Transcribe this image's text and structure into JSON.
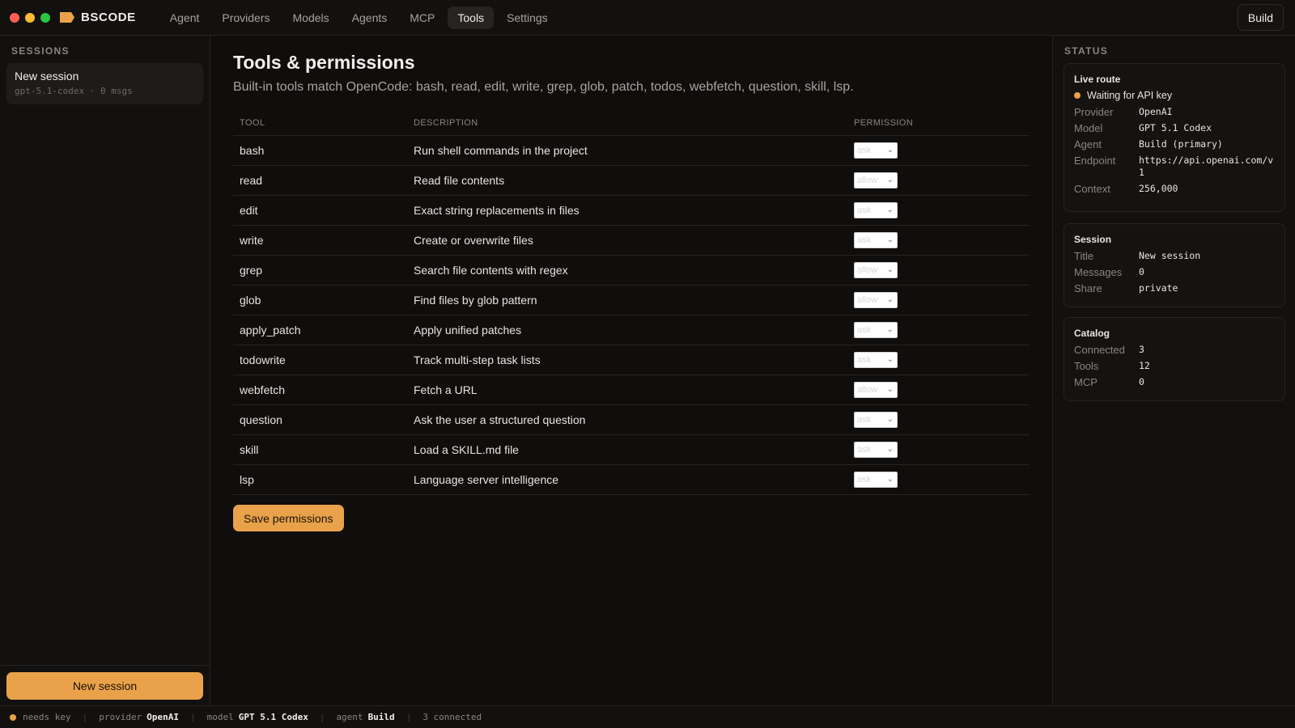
{
  "window": {
    "controls": [
      "#ff5f57",
      "#febc2e",
      "#28c840"
    ],
    "brand": "BSCODE",
    "accent_color": "#e9a24a"
  },
  "nav": {
    "tabs": [
      {
        "label": "Agent"
      },
      {
        "label": "Providers"
      },
      {
        "label": "Models"
      },
      {
        "label": "Agents"
      },
      {
        "label": "MCP"
      },
      {
        "label": "Tools",
        "active": true
      },
      {
        "label": "Settings"
      }
    ],
    "build_label": "Build"
  },
  "sidebar": {
    "title": "SESSIONS",
    "sessions": [
      {
        "title": "New session",
        "meta": "gpt-5.1-codex · 0 msgs"
      }
    ],
    "new_session_label": "New session"
  },
  "main": {
    "title": "Tools & permissions",
    "subtitle": "Built-in tools match OpenCode: bash, read, edit, write, grep, glob, patch, todos, webfetch, question, skill, lsp.",
    "columns": [
      "TOOL",
      "DESCRIPTION",
      "PERMISSION"
    ],
    "tools": [
      {
        "name": "bash",
        "description": "Run shell commands in the project",
        "permission": "ask"
      },
      {
        "name": "read",
        "description": "Read file contents",
        "permission": "allow"
      },
      {
        "name": "edit",
        "description": "Exact string replacements in files",
        "permission": "ask"
      },
      {
        "name": "write",
        "description": "Create or overwrite files",
        "permission": "ask"
      },
      {
        "name": "grep",
        "description": "Search file contents with regex",
        "permission": "allow"
      },
      {
        "name": "glob",
        "description": "Find files by glob pattern",
        "permission": "allow"
      },
      {
        "name": "apply_patch",
        "description": "Apply unified patches",
        "permission": "ask"
      },
      {
        "name": "todowrite",
        "description": "Track multi-step task lists",
        "permission": "ask"
      },
      {
        "name": "webfetch",
        "description": "Fetch a URL",
        "permission": "allow"
      },
      {
        "name": "question",
        "description": "Ask the user a structured question",
        "permission": "ask"
      },
      {
        "name": "skill",
        "description": "Load a SKILL.md file",
        "permission": "ask"
      },
      {
        "name": "lsp",
        "description": "Language server intelligence",
        "permission": "ask"
      }
    ],
    "save_label": "Save permissions"
  },
  "status": {
    "title": "STATUS",
    "live_route": {
      "title": "Live route",
      "state": "Waiting for API key",
      "rows": [
        {
          "k": "Provider",
          "v": "OpenAI"
        },
        {
          "k": "Model",
          "v": "GPT 5.1 Codex"
        },
        {
          "k": "Agent",
          "v": "Build (primary)"
        },
        {
          "k": "Endpoint",
          "v": "https://api.openai.com/v1"
        },
        {
          "k": "Context",
          "v": "256,000"
        }
      ]
    },
    "session": {
      "title": "Session",
      "rows": [
        {
          "k": "Title",
          "v": "New session"
        },
        {
          "k": "Messages",
          "v": "0"
        },
        {
          "k": "Share",
          "v": "private"
        }
      ]
    },
    "catalog": {
      "title": "Catalog",
      "rows": [
        {
          "k": "Connected",
          "v": "3"
        },
        {
          "k": "Tools",
          "v": "12"
        },
        {
          "k": "MCP",
          "v": "0"
        }
      ]
    }
  },
  "statusbar": {
    "key_state": "needs key",
    "provider_label": "provider",
    "provider": "OpenAI",
    "model_label": "model",
    "model": "GPT 5.1 Codex",
    "agent_label": "agent",
    "agent": "Build",
    "connected": "3 connected"
  }
}
